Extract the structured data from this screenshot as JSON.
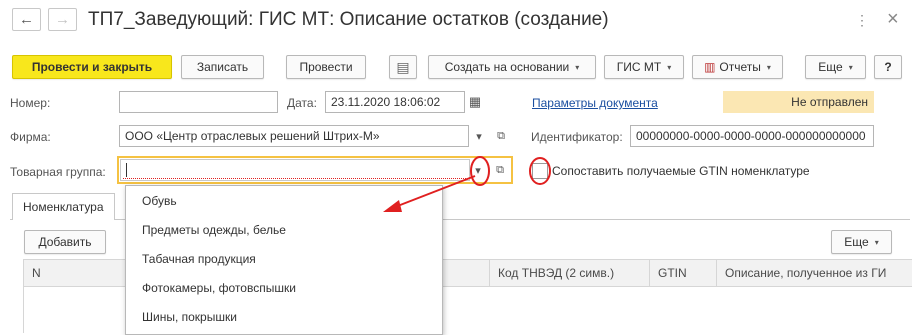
{
  "window": {
    "title": "ТП7_Заведующий: ГИС МТ: Описание остатков (создание)",
    "nav_back": "←",
    "nav_forward": "→",
    "link_icon": "link-icon",
    "menu_icon": "more-vertical-icon",
    "close_icon": "close-icon",
    "menu_glyph": "⋮",
    "close_glyph": "×",
    "link_glyph": "🔗"
  },
  "toolbar": {
    "post_close": "Провести и закрыть",
    "save": "Записать",
    "post": "Провести",
    "doc_icon_glyph": "▤",
    "create_based": "Создать на основании",
    "gis_mt": "ГИС МТ",
    "reports": "Отчеты",
    "reports_icon_glyph": "▥",
    "more": "Еще",
    "help": "?",
    "caret": "▾"
  },
  "header": {
    "number_label": "Номер:",
    "number_value": "",
    "date_label": "Дата:",
    "date_value": "23.11.2020 18:06:02",
    "calendar_glyph": "▦",
    "params_link": "Параметры документа",
    "status": "Не отправлен"
  },
  "form": {
    "company_label": "Фирма:",
    "company_value": "ООО «Центр отраслевых решений Штрих-М»",
    "dd_glyph": "▾",
    "open_glyph": "⧉",
    "identifier_label": "Идентификатор:",
    "identifier_value": "00000000-0000-0000-0000-000000000000",
    "product_group_label": "Товарная группа:",
    "product_group_value": "",
    "match_gtin_label": "Сопоставить получаемые GTIN номенклатуре",
    "match_gtin_checked": false
  },
  "tabs": [
    {
      "label": "Номенклатура"
    }
  ],
  "table": {
    "add_button": "Добавить",
    "more_button": "Еще",
    "columns": [
      "N",
      "Код ТНВЭД (2 симв.)",
      "GTIN",
      "Описание, полученное из ГИ"
    ]
  },
  "dropdown": {
    "items": [
      "Обувь",
      "Предметы одежды, белье",
      "Табачная продукция",
      "Фотокамеры, фотовспышки",
      "Шины, покрышки"
    ]
  },
  "colors": {
    "primary_button": "#f8e71c",
    "status_bg": "#fbe7b3",
    "highlight_border": "#f5c242",
    "annotation_red": "#e02020",
    "link": "#1b4fa0"
  }
}
